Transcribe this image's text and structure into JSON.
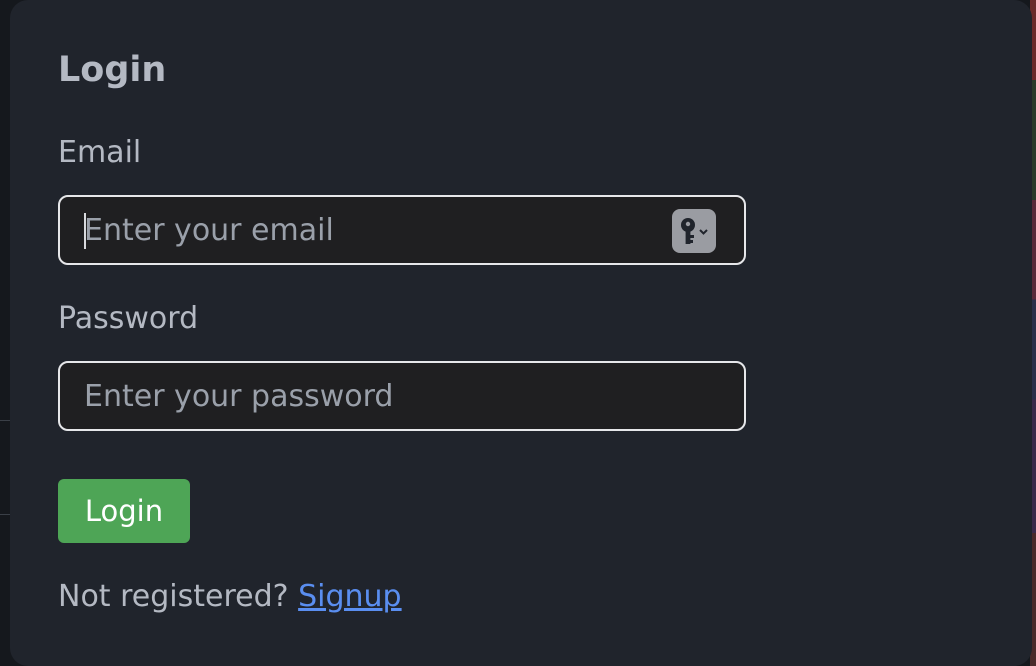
{
  "login_modal": {
    "title": "Login",
    "email_label": "Email",
    "email_placeholder": "Enter your email",
    "email_value": "",
    "password_label": "Password",
    "password_placeholder": "Enter your password",
    "password_value": "",
    "login_button_label": "Login",
    "signup_prompt": "Not registered?",
    "signup_link_label": "Signup"
  },
  "icons": {
    "password_manager": "key-icon",
    "dropdown": "chevron-down-icon"
  },
  "colors": {
    "modal_background": "#20242c",
    "input_border": "#e6e7ea",
    "button_green": "#4ea556",
    "link_blue": "#5a8ef0",
    "text": "#b4b9c3"
  }
}
